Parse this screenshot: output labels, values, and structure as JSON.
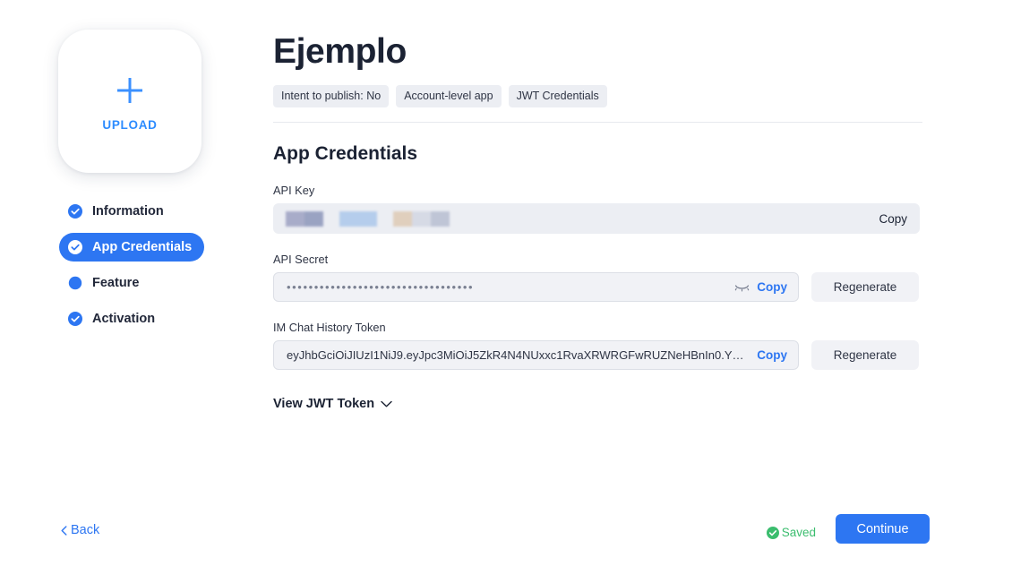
{
  "upload": {
    "label": "UPLOAD",
    "icon": "plus-icon",
    "accent_color": "#2d8cff"
  },
  "sidebar": {
    "items": [
      {
        "label": "Information",
        "icon": "check-circle-icon",
        "state": "complete",
        "active": false
      },
      {
        "label": "App Credentials",
        "icon": "check-circle-icon",
        "state": "complete",
        "active": true
      },
      {
        "label": "Feature",
        "icon": "filled-dot-icon",
        "state": "current",
        "active": false
      },
      {
        "label": "Activation",
        "icon": "check-circle-icon",
        "state": "complete",
        "active": false
      }
    ],
    "active_background": "#2d76f2"
  },
  "header": {
    "title": "Ejemplo",
    "badges": [
      "Intent to publish: No",
      "Account-level app",
      "JWT Credentials"
    ]
  },
  "credentials": {
    "section_title": "App Credentials",
    "api_key": {
      "label": "API Key",
      "value": "",
      "redacted": true,
      "copy_label": "Copy"
    },
    "api_secret": {
      "label": "API Secret",
      "value": "••••••••••••••••••••••••••••••••••",
      "masked": true,
      "visibility_icon": "eye-off-icon",
      "copy_label": "Copy",
      "regenerate_label": "Regenerate"
    },
    "im_chat_history_token": {
      "label": "IM Chat History Token",
      "value": "eyJhbGciOiJIUzI1NiJ9.eyJpc3MiOiJ5ZkR4N4NUxxc1RvaXRWRGFwRUZNeHBnIn0.Y…",
      "copy_label": "Copy",
      "regenerate_label": "Regenerate"
    },
    "view_jwt_token": {
      "label": "View JWT Token",
      "icon": "chevron-down-icon",
      "expanded": false
    }
  },
  "footer": {
    "back_label": "Back",
    "back_icon": "chevron-left-icon",
    "saved_label": "Saved",
    "saved_icon": "check-circle-icon",
    "saved_color": "#3bbd6e",
    "continue_label": "Continue",
    "continue_color": "#2d76f2"
  }
}
